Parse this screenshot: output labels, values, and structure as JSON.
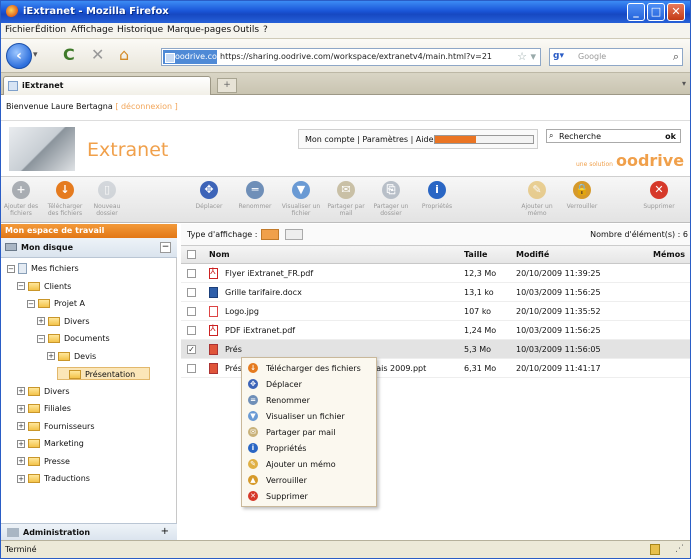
{
  "window": {
    "title": "iExtranet - Mozilla Firefox",
    "minimize": "_",
    "maximize": "□",
    "close": "✕"
  },
  "menu": [
    "Fichier",
    "Édition",
    "Affichage",
    "Historique",
    "Marque-pages",
    "Outils",
    "?"
  ],
  "nav": {
    "site_badge": "oodrive.com",
    "url": "https://sharing.oodrive.com/workspace/extranetv4/main.html?v=21",
    "search_engine": "Google",
    "search_placeholder": "Google"
  },
  "tab": {
    "label": "iExtranet",
    "new": "+"
  },
  "page": {
    "welcome": "Bienvenue Laure Bertagna",
    "logout": "[ déconnexion ]",
    "brand": "Extranet",
    "account_links": "Mon compte | Paramètres | Aide",
    "quota_fraction": 0.42,
    "search_placeholder": "Recherche",
    "search_ok": "ok",
    "vendor_small": "une solution",
    "vendor": "oodrive"
  },
  "toolbar": [
    {
      "label": "Ajouter des fichiers",
      "icon": "plus-icon",
      "color": "#6e7680",
      "glyph": "+"
    },
    {
      "label": "Télécharger des fichiers",
      "icon": "download-icon",
      "color": "#e57b1f",
      "glyph": "↓"
    },
    {
      "label": "Nouveau dossier",
      "icon": "new-folder-icon",
      "color": "#b9c0c8",
      "glyph": "▯"
    },
    {
      "label": "Déplacer",
      "icon": "move-icon",
      "color": "#3d64b8",
      "glyph": "✥"
    },
    {
      "label": "Renommer",
      "icon": "rename-icon",
      "color": "#6f8fb8",
      "glyph": "═"
    },
    {
      "label": "Visualiser un fichier",
      "icon": "view-icon",
      "color": "#6a9ad4",
      "glyph": "▼"
    },
    {
      "label": "Partager par mail",
      "icon": "share-mail-icon",
      "color": "#c9c0a6",
      "glyph": "✉"
    },
    {
      "label": "Partager un dossier",
      "icon": "share-folder-icon",
      "color": "#b8bfc8",
      "glyph": "⎘"
    },
    {
      "label": "Propriétés",
      "icon": "properties-icon",
      "color": "#2a66c4",
      "glyph": "i"
    },
    {
      "label": "Ajouter un mémo",
      "icon": "memo-icon",
      "color": "#e0b044",
      "glyph": "✎"
    },
    {
      "label": "Verrouiller",
      "icon": "lock-icon",
      "color": "#d69a2a",
      "glyph": "🔒"
    },
    {
      "label": "Supprimer",
      "icon": "delete-icon",
      "color": "#d6392a",
      "glyph": "✕"
    }
  ],
  "left": {
    "header": "Mon espace de travail",
    "disk": "Mon disque",
    "collapse": "−",
    "tree": [
      {
        "label": "Mes fichiers",
        "level": 0,
        "exp": "−",
        "type": "file"
      },
      {
        "label": "Clients",
        "level": 1,
        "exp": "−",
        "type": "folder"
      },
      {
        "label": "Projet A",
        "level": 2,
        "exp": "−",
        "type": "folder"
      },
      {
        "label": "Divers",
        "level": 3,
        "exp": "+",
        "type": "folder"
      },
      {
        "label": "Documents",
        "level": 3,
        "exp": "−",
        "type": "folder"
      },
      {
        "label": "Devis",
        "level": 4,
        "exp": "+",
        "type": "folder"
      },
      {
        "label": "Présentation",
        "level": 5,
        "exp": "",
        "type": "folder",
        "selected": true
      },
      {
        "label": "Divers",
        "level": 1,
        "exp": "+",
        "type": "folder"
      },
      {
        "label": "Filiales",
        "level": 1,
        "exp": "+",
        "type": "folder"
      },
      {
        "label": "Fournisseurs",
        "level": 1,
        "exp": "+",
        "type": "folder"
      },
      {
        "label": "Marketing",
        "level": 1,
        "exp": "+",
        "type": "folder"
      },
      {
        "label": "Presse",
        "level": 1,
        "exp": "+",
        "type": "folder"
      },
      {
        "label": "Traductions",
        "level": 1,
        "exp": "+",
        "type": "folder"
      }
    ],
    "admin": "Administration",
    "admin_plus": "+"
  },
  "list": {
    "display_type": "Type d'affichage :",
    "count_label": "Nombre d'élément(s) : 6",
    "headers": {
      "name": "Nom",
      "size": "Taille",
      "modified": "Modifié",
      "memo": "Mémos"
    },
    "rows": [
      {
        "name": "Flyer iExtranet_FR.pdf",
        "size": "12,3 Mo",
        "modified": "20/10/2009 11:39:25",
        "type": "pdf",
        "checked": false
      },
      {
        "name": "Grille tarifaire.docx",
        "size": "13,1 ko",
        "modified": "10/03/2009 11:56:25",
        "type": "doc",
        "checked": false
      },
      {
        "name": "Logo.jpg",
        "size": "107 ko",
        "modified": "20/10/2009 11:35:52",
        "type": "jpg",
        "checked": false
      },
      {
        "name": "PDF iExtranet.pdf",
        "size": "1,24 Mo",
        "modified": "10/03/2009 11:56:25",
        "type": "pdf",
        "checked": false
      },
      {
        "name": "Prés",
        "size": "5,3 Mo",
        "modified": "10/03/2009 11:56:05",
        "type": "ppt",
        "checked": true
      },
      {
        "name": "Prés",
        "name_tail": "lais 2009.ppt",
        "size": "6,31 Mo",
        "modified": "20/10/2009 11:41:17",
        "type": "ppt",
        "checked": false
      }
    ]
  },
  "context_menu": [
    {
      "label": "Télécharger des fichiers",
      "icon": "download-icon",
      "color": "#e57b1f",
      "glyph": "↓"
    },
    {
      "label": "Déplacer",
      "icon": "move-icon",
      "color": "#3d64b8",
      "glyph": "✥"
    },
    {
      "label": "Renommer",
      "icon": "rename-icon",
      "color": "#6f8fb8",
      "glyph": "="
    },
    {
      "label": "Visualiser un fichier",
      "icon": "view-icon",
      "color": "#6a9ad4",
      "glyph": "▼"
    },
    {
      "label": "Partager par mail",
      "icon": "share-mail-icon",
      "color": "#c9b27a",
      "glyph": "✉"
    },
    {
      "label": "Propriétés",
      "icon": "properties-icon",
      "color": "#2a66c4",
      "glyph": "i"
    },
    {
      "label": "Ajouter un mémo",
      "icon": "memo-icon",
      "color": "#e0b044",
      "glyph": "✎"
    },
    {
      "label": "Verrouiller",
      "icon": "lock-icon",
      "color": "#d69a2a",
      "glyph": "▲"
    },
    {
      "label": "Supprimer",
      "icon": "delete-icon",
      "color": "#d6392a",
      "glyph": "✕"
    }
  ],
  "status": {
    "text": "Terminé"
  }
}
